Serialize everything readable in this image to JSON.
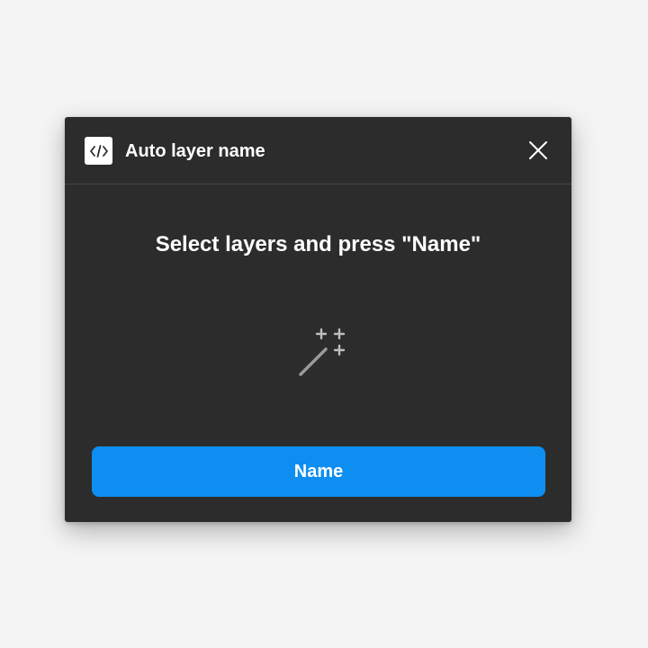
{
  "window": {
    "title": "Auto layer name",
    "plugin_icon": "code-brackets-icon",
    "close_icon": "close-icon"
  },
  "main": {
    "instruction": "Select layers and press \"Name\"",
    "illustration_icon": "magic-wand-icon"
  },
  "actions": {
    "name_label": "Name"
  },
  "colors": {
    "page_background": "#f4f4f4",
    "dialog_background": "#2c2c2c",
    "primary_button": "#0d8ef0",
    "text": "#ffffff"
  }
}
